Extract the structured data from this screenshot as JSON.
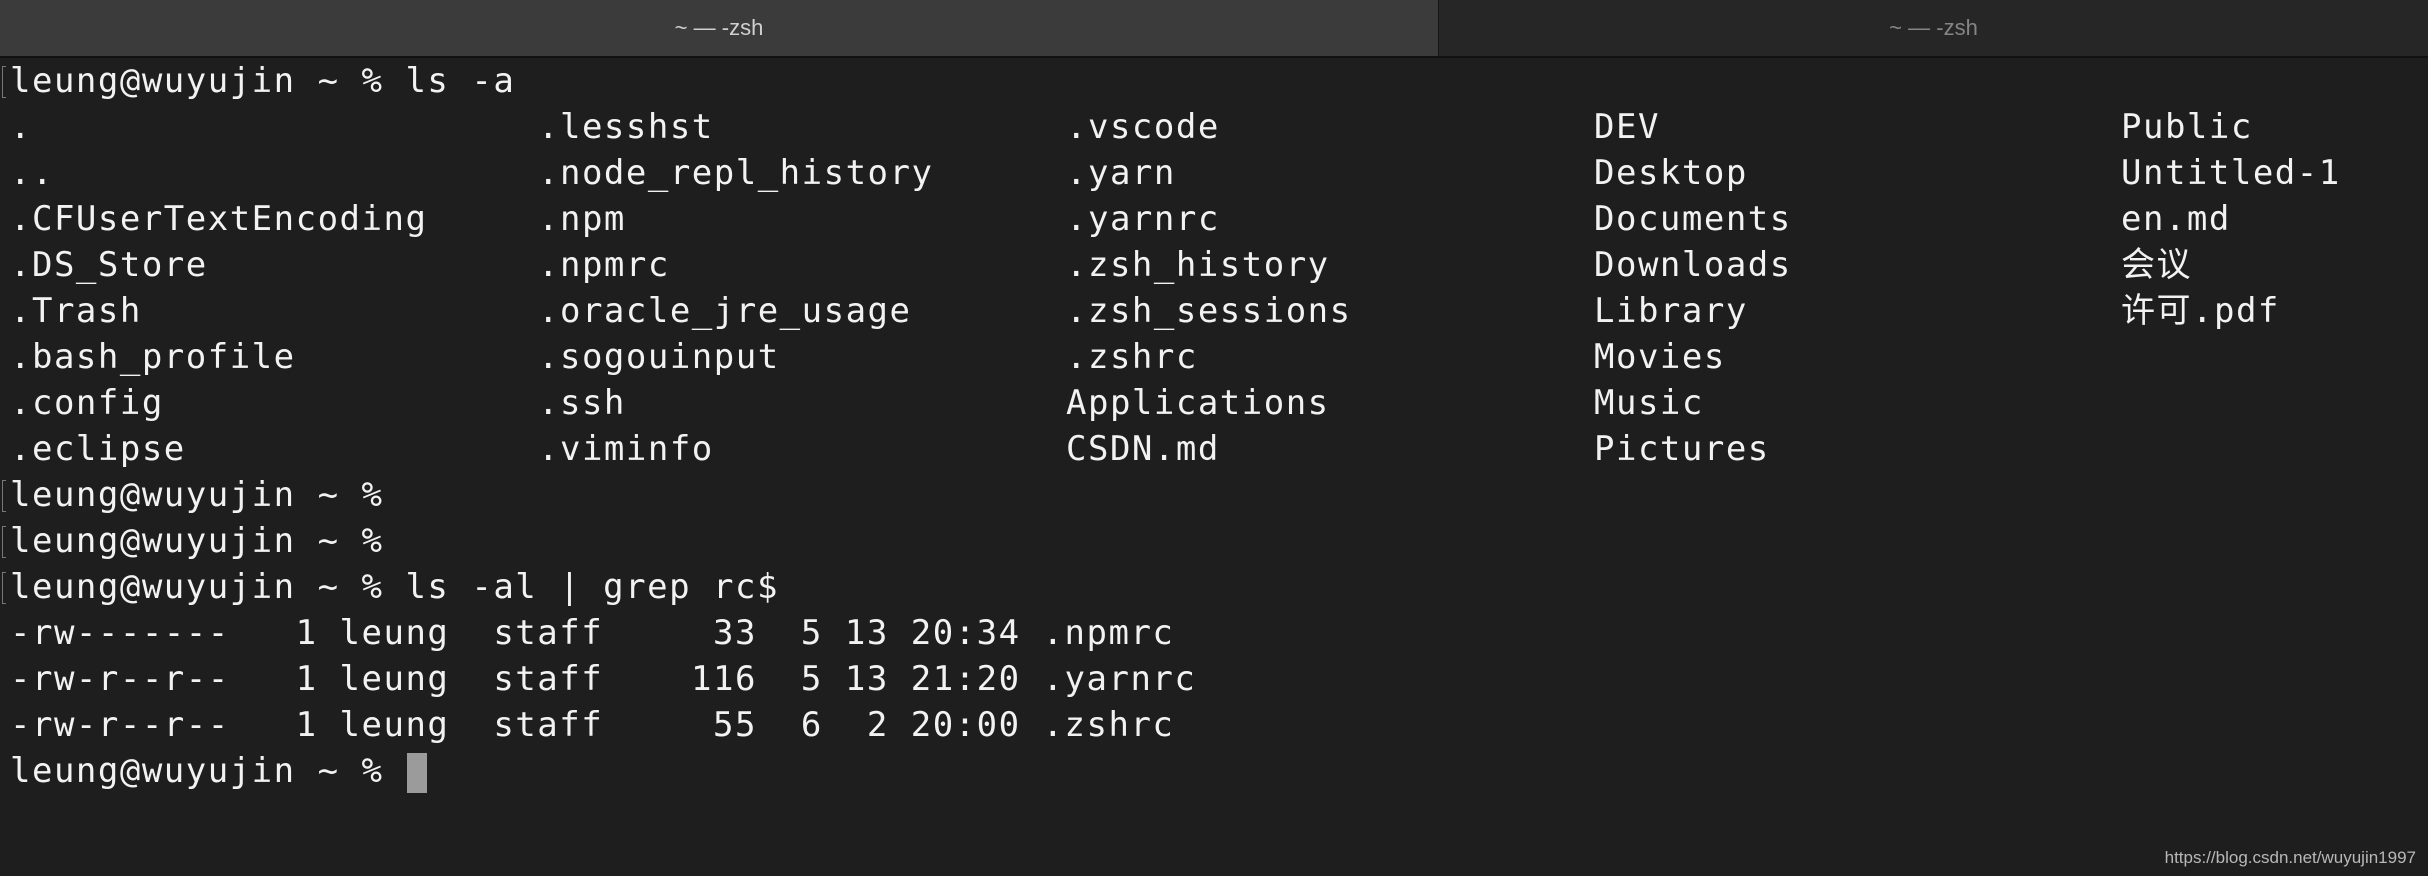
{
  "tabs": [
    {
      "title": "~ — -zsh",
      "active": true
    },
    {
      "title": "~ — -zsh",
      "active": false
    }
  ],
  "terminal": {
    "cmd1": "leung@wuyujin ~ % ls -a",
    "ls_columns": [
      [
        ".",
        "..",
        ".CFUserTextEncoding",
        ".DS_Store",
        ".Trash",
        ".bash_profile",
        ".config",
        ".eclipse"
      ],
      [
        ".lesshst",
        ".node_repl_history",
        ".npm",
        ".npmrc",
        ".oracle_jre_usage",
        ".sogouinput",
        ".ssh",
        ".viminfo"
      ],
      [
        ".vscode",
        ".yarn",
        ".yarnrc",
        ".zsh_history",
        ".zsh_sessions",
        ".zshrc",
        "Applications",
        "CSDN.md"
      ],
      [
        "DEV",
        "Desktop",
        "Documents",
        "Downloads",
        "Library",
        "Movies",
        "Music",
        "Pictures"
      ],
      [
        "Public",
        "Untitled-1",
        "en.md",
        "会议",
        "许可.pdf",
        "",
        "",
        ""
      ]
    ],
    "prompt2": "leung@wuyujin ~ %",
    "prompt3": "leung@wuyujin ~ %",
    "cmd2": "leung@wuyujin ~ % ls -al | grep rc$",
    "grep_output": [
      "-rw-------   1 leung  staff     33  5 13 20:34 .npmrc",
      "-rw-r--r--   1 leung  staff    116  5 13 21:20 .yarnrc",
      "-rw-r--r--   1 leung  staff     55  6  2 20:00 .zshrc"
    ],
    "current_prompt": "leung@wuyujin ~ % "
  },
  "watermark": "https://blog.csdn.net/wuyujin1997",
  "colors": {
    "background": "#1e1e1e",
    "text": "#f2f2f2",
    "cursor": "#9b9b9b"
  }
}
